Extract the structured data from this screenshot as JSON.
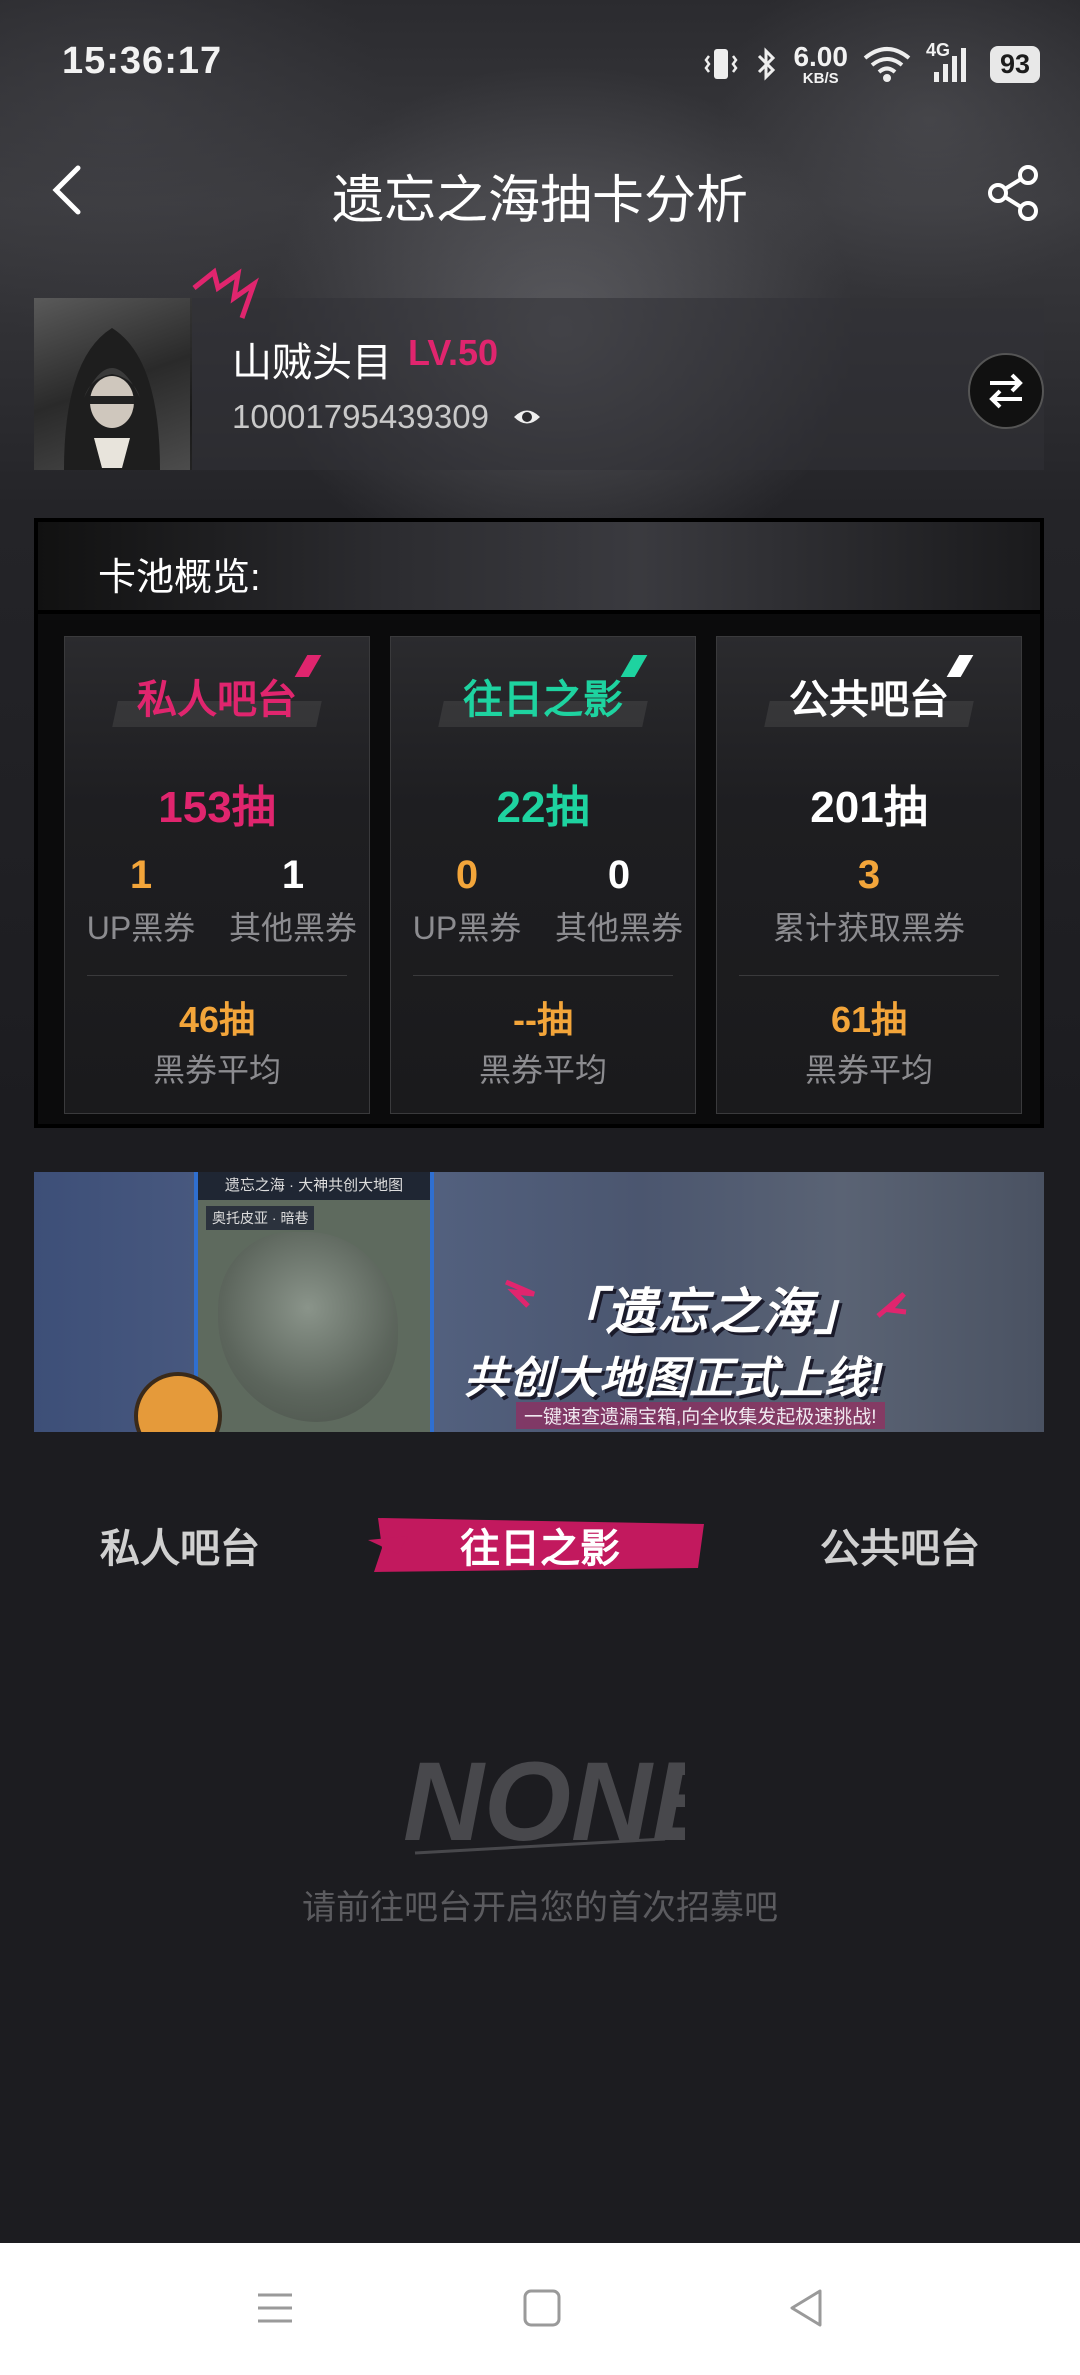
{
  "status_bar": {
    "time": "15:36:17",
    "net_speed": "6.00",
    "net_unit": "KB/S",
    "signal_label": "4G",
    "battery": "93"
  },
  "header": {
    "title": "遗忘之海抽卡分析",
    "back_icon": "chevron-left-icon",
    "share_icon": "share-icon"
  },
  "user": {
    "name": "山贼头目",
    "level": "LV.50",
    "uid": "10001795439309",
    "level_color": "#e0256e"
  },
  "overview": {
    "title": "卡池概览:",
    "pools": [
      {
        "name": "私人吧台",
        "color": "#e0256e",
        "pulls": "153抽",
        "up_count": "1",
        "up_label": "UP黑券",
        "other_count": "1",
        "other_label": "其他黑券",
        "avg": "46抽",
        "avg_label": "黑券平均"
      },
      {
        "name": "往日之影",
        "color": "#1ed3a0",
        "pulls": "22抽",
        "up_count": "0",
        "up_label": "UP黑券",
        "other_count": "0",
        "other_label": "其他黑券",
        "avg": "--抽",
        "avg_label": "黑券平均"
      },
      {
        "name": "公共吧台",
        "color": "#ffffff",
        "pulls": "201抽",
        "total_count": "3",
        "total_label": "累计获取黑券",
        "avg": "61抽",
        "avg_label": "黑券平均"
      }
    ]
  },
  "banner": {
    "map_title": "遗忘之海 · 大神共创大地图",
    "map_filter": "奥托皮亚 · 暗巷",
    "headline_1": "「遗忘之海」",
    "headline_2": "共创大地图正式上线!",
    "subtitle": "一键速查遗漏宝箱,向全收集发起极速挑战!"
  },
  "tabs": {
    "items": [
      "私人吧台",
      "往日之影",
      "公共吧台"
    ],
    "active_index": 1,
    "accent": "#c2195e"
  },
  "empty_state": {
    "art_text": "NONE",
    "message": "请前往吧台开启您的首次招募吧"
  },
  "nav": {
    "menu_icon": "menu-icon",
    "home_icon": "home-icon",
    "back_icon": "back-triangle-icon"
  }
}
